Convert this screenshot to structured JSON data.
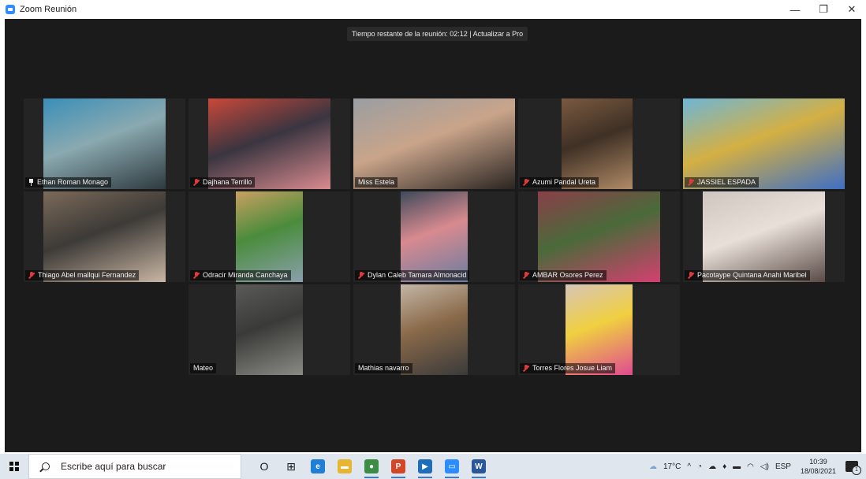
{
  "window": {
    "title": "Zoom Reunión",
    "minimize": "—",
    "restore": "❐",
    "close": "✕"
  },
  "meeting": {
    "banner": "Tiempo restante de la reunión: 02:12 | Actualizar a Pro",
    "participants": [
      {
        "name": "Ethan Roman Monago",
        "status_icon": "pin-icon",
        "colors": [
          "#3a8fb8",
          "#2e3a3f",
          "#8aa9b0"
        ]
      },
      {
        "name": "Dajhana Terrillo",
        "status_icon": "muted-mic-icon",
        "colors": [
          "#c9483a",
          "#d98a8f",
          "#3a3540"
        ]
      },
      {
        "name": "Miss Estela",
        "status_icon": "",
        "active_speaker": true,
        "colors": [
          "#9a9ea2",
          "#2b2522",
          "#c9a48a"
        ]
      },
      {
        "name": "Azumi Pandal Ureta",
        "status_icon": "muted-mic-icon",
        "colors": [
          "#7a5a40",
          "#b08a66",
          "#3f3025"
        ]
      },
      {
        "name": "JASSIEL ESPADA",
        "status_icon": "muted-mic-icon",
        "colors": [
          "#6db6d6",
          "#3e6fc4",
          "#d4b043"
        ]
      },
      {
        "name": "Thiago Abel mallqui Fernandez",
        "status_icon": "muted-mic-icon",
        "colors": [
          "#7b6a5a",
          "#c9b6a4",
          "#3d3a37"
        ]
      },
      {
        "name": "Odracir Miranda  Canchaya",
        "status_icon": "muted-mic-icon",
        "colors": [
          "#c9a060",
          "#8aa0ac",
          "#4a8c3c"
        ]
      },
      {
        "name": "Dylan Caleb Tamara Almonacid",
        "status_icon": "muted-mic-icon",
        "colors": [
          "#3f4a5a",
          "#6a7da0",
          "#d88a90"
        ]
      },
      {
        "name": "AMBAR Osores  Perez",
        "status_icon": "muted-mic-icon",
        "colors": [
          "#8a3f4a",
          "#d44070",
          "#4a6a3a"
        ]
      },
      {
        "name": "Pacotaype Quintana Anahi Maribel",
        "status_icon": "muted-mic-icon",
        "colors": [
          "#cfc5c0",
          "#5a4a45",
          "#e8e0d8"
        ]
      },
      {
        "name": "Mateo",
        "status_icon": "",
        "colors": [
          "#5a5a58",
          "#8a8a85",
          "#3a3a38"
        ]
      },
      {
        "name": "Mathias navarro",
        "status_icon": "",
        "colors": [
          "#c4b6a6",
          "#3a3a3a",
          "#8a6a4a"
        ]
      },
      {
        "name": "Torres Flores Josue Liam",
        "status_icon": "muted-mic-icon",
        "colors": [
          "#d8c4b8",
          "#e04a90",
          "#f0d040"
        ]
      }
    ]
  },
  "taskbar": {
    "search_placeholder": "Escribe aquí para buscar",
    "apps": [
      {
        "icon": "cortana-icon",
        "label": "O",
        "color": "#1a1a1a"
      },
      {
        "icon": "task-view-icon",
        "label": "⊞",
        "color": "#1a1a1a"
      },
      {
        "icon": "edge-icon",
        "label": "e",
        "color": "#1f7ed6"
      },
      {
        "icon": "file-explorer-icon",
        "label": "▬",
        "color": "#e8b530"
      },
      {
        "icon": "chrome-icon",
        "label": "●",
        "color": "#3b8c45"
      },
      {
        "icon": "powerpoint-icon",
        "label": "P",
        "color": "#d24726"
      },
      {
        "icon": "media-player-icon",
        "label": "▶",
        "color": "#1e6fb8"
      },
      {
        "icon": "zoom-icon",
        "label": "▭",
        "color": "#2d8cff"
      },
      {
        "icon": "word-icon",
        "label": "W",
        "color": "#2b579a"
      }
    ],
    "weather": "17°C",
    "language": "ESP",
    "time": "10:39",
    "date": "18/08/2021"
  }
}
